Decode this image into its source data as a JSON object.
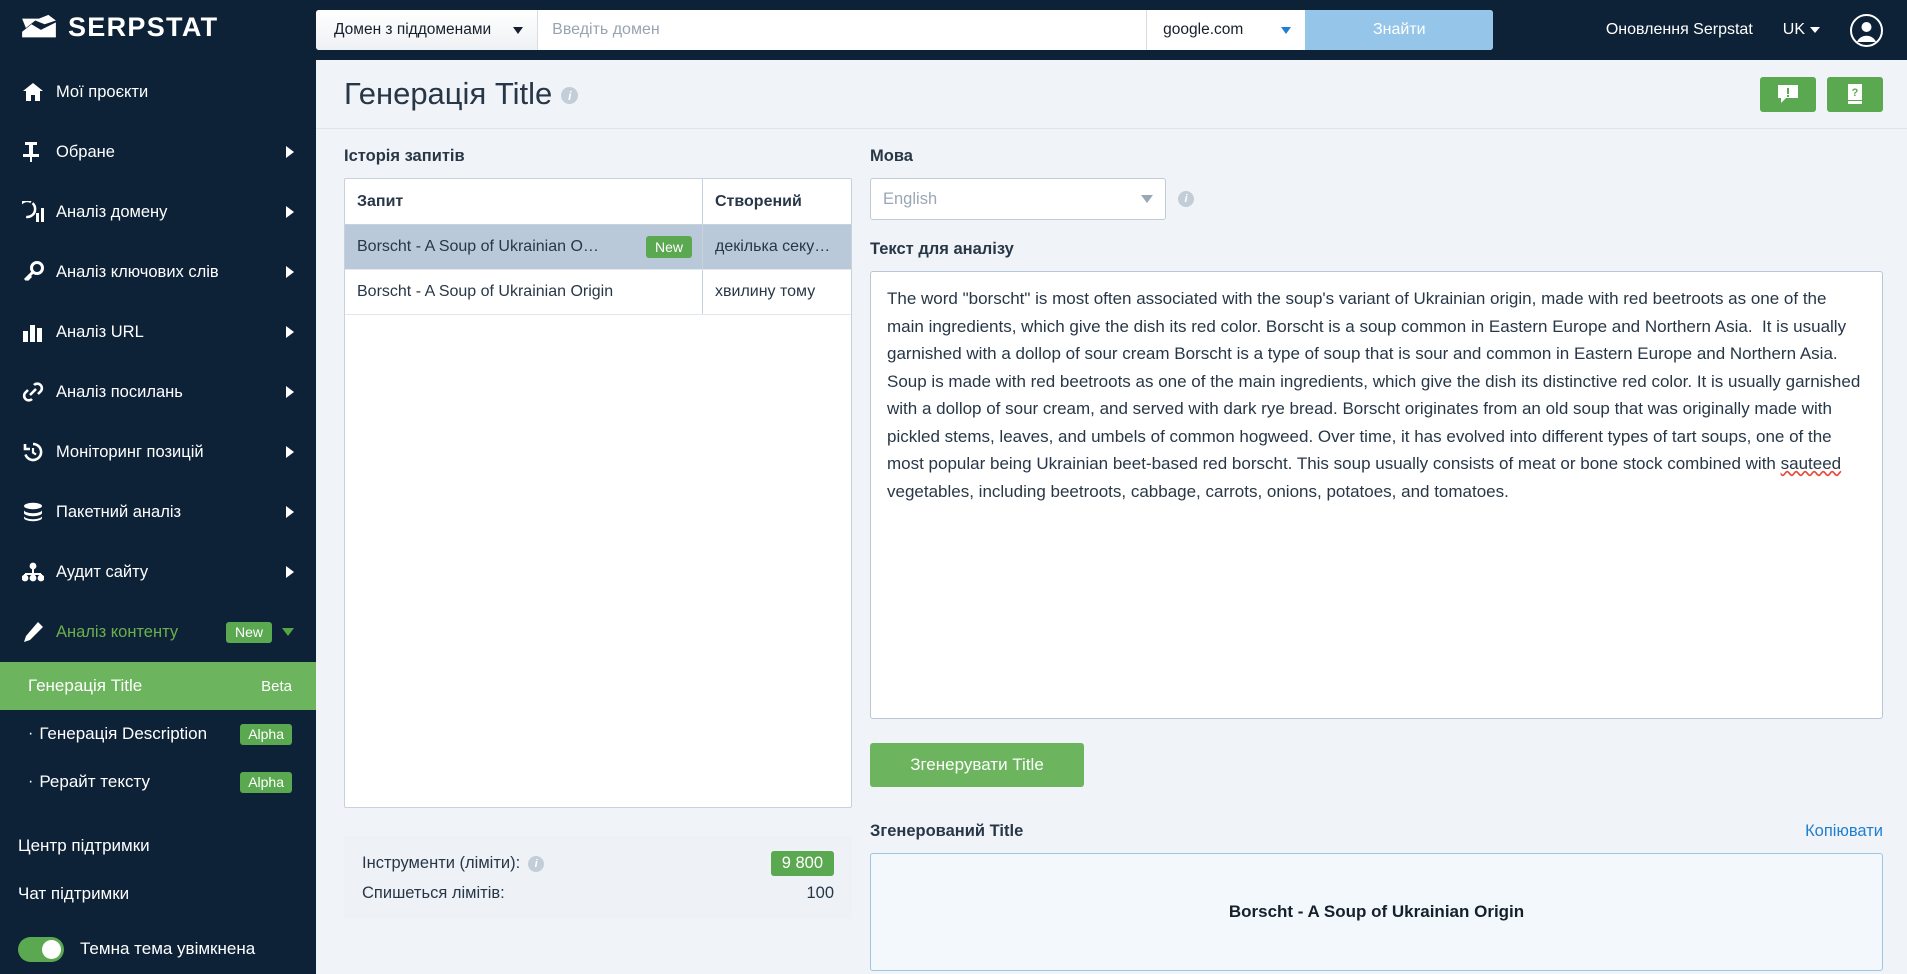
{
  "brand": {
    "name": "SERPSTAT"
  },
  "topbar": {
    "domain_scope": "Домен з піддоменами",
    "domain_placeholder": "Введіть домен",
    "domain_value": "",
    "search_engine": "google.com",
    "find_label": "Знайти",
    "updates_link": "Оновлення Serpstat",
    "language": "UK"
  },
  "sidebar": {
    "items": [
      {
        "label": "Мої проєкти",
        "icon": "home-icon",
        "expand": false
      },
      {
        "label": "Обране",
        "icon": "pin-icon",
        "expand": true
      },
      {
        "label": "Аналіз домену",
        "icon": "domain-chart-icon",
        "expand": true
      },
      {
        "label": "Аналіз ключових слів",
        "icon": "key-icon",
        "expand": true
      },
      {
        "label": "Аналіз URL",
        "icon": "bar-chart-icon",
        "expand": true
      },
      {
        "label": "Аналіз посилань",
        "icon": "link-icon",
        "expand": true
      },
      {
        "label": "Моніторинг позицій",
        "icon": "history-clock-icon",
        "expand": true
      },
      {
        "label": "Пакетний аналіз",
        "icon": "database-icon",
        "expand": true
      },
      {
        "label": "Аудит сайту",
        "icon": "sitemap-icon",
        "expand": true
      },
      {
        "label": "Аналіз контенту",
        "icon": "pencil-icon",
        "badge": "New",
        "expand": "down"
      }
    ],
    "sub_items": [
      {
        "label": "Генерація Title",
        "tag": "Beta",
        "active": true
      },
      {
        "label": "Генерація Description",
        "tag": "Alpha",
        "active": false
      },
      {
        "label": "Рерайт тексту",
        "tag": "Alpha",
        "active": false
      }
    ],
    "support_center": "Центр підтримки",
    "support_chat": "Чат підтримки",
    "theme_label": "Темна тема увімкнена",
    "theme_on": true
  },
  "page": {
    "title": "Генерація Title",
    "feedback_icon": "feedback-exclamation-icon",
    "help_icon": "help-book-icon"
  },
  "history": {
    "section_label": "Історія запитів",
    "columns": [
      "Запит",
      "Створений"
    ],
    "rows": [
      {
        "query": "Borscht - A Soup of Ukrainian O…",
        "badge": "New",
        "created": "декілька секу…",
        "selected": true
      },
      {
        "query": "Borscht - A Soup of Ukrainian Origin",
        "badge": "",
        "created": "хвилину тому",
        "selected": false
      }
    ]
  },
  "limits": {
    "tools_label": "Інструменти (ліміти):",
    "tools_value": "9 800",
    "charge_label": "Спишеться лімітів:",
    "charge_value": "100"
  },
  "form": {
    "language_label": "Мова",
    "language_value": "English",
    "text_label": "Текст для аналізу",
    "text_value": "The word \"borscht\" is most often associated with the soup's variant of Ukrainian origin, made with red beetroots as one of the main ingredients, which give the dish its red color. Borscht is a soup common in Eastern Europe and Northern Asia.  It is usually garnished with a dollop of sour cream Borscht is a type of soup that is sour and common in Eastern Europe and Northern Asia. Soup is made with red beetroots as one of the main ingredients, which give the dish its distinctive red color. It is usually garnished with a dollop of sour cream, and served with dark rye bread. Borscht originates from an old soup that was originally made with pickled stems, leaves, and umbels of common hogweed. Over time, it has evolved into different types of tart soups, one of the most popular being Ukrainian beet-based red borscht. This soup usually consists of meat or bone stock combined with sauteed vegetables, including beetroots, cabbage, carrots, onions, potatoes, and tomatoes.",
    "generate_label": "Згенерувати Title"
  },
  "result": {
    "label": "Згенерований Title",
    "copy_label": "Копіювати",
    "value": "Borscht - A Soup of Ukrainian Origin"
  },
  "colors": {
    "sidebar_bg": "#0d2137",
    "accent_green": "#5aa84f",
    "accent_blue": "#1f7fd0",
    "find_button": "#95c6ea"
  }
}
